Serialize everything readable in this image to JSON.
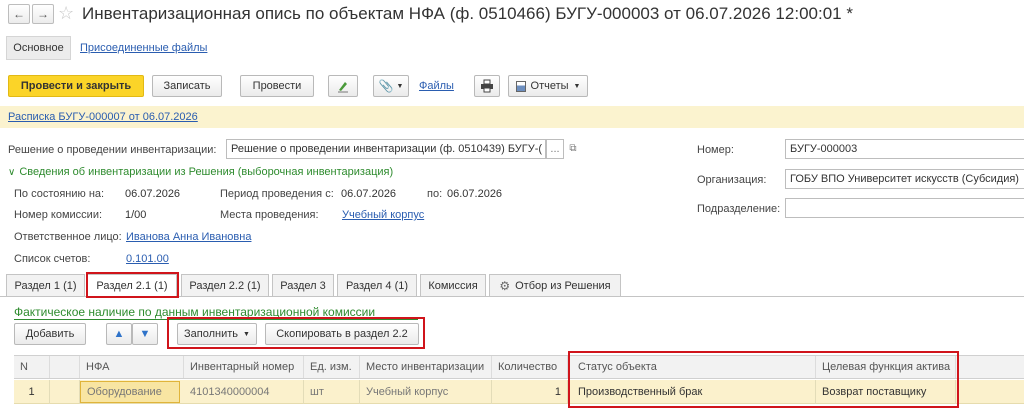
{
  "window": {
    "title": "Инвентаризационная опись по объектам НФА (ф. 0510466) БУГУ-000003 от 06.07.2026 12:00:01 *"
  },
  "top_tabs": {
    "main": "Основное",
    "attached": "Присоединенные файлы"
  },
  "toolbar": {
    "post_close": "Провести и закрыть",
    "save": "Записать",
    "post": "Провести",
    "files": "Файлы",
    "reports": "Отчеты"
  },
  "receipt_link": "Расписка БУГУ-000007 от 06.07.2026",
  "decision": {
    "label": "Решение о проведении инвентаризации:",
    "value": "Решение о проведении инвентаризации (ф. 0510439) БУГУ-("
  },
  "right_fields": {
    "number_label": "Номер:",
    "number_value": "БУГУ-000003",
    "org_label": "Организация:",
    "org_value": "ГОБУ ВПО Университет искусств (Субсидия)",
    "dept_label": "Подразделение:",
    "dept_value": ""
  },
  "section_info": {
    "title": "Сведения об инвентаризации из Решения (выборочная инвентаризация)",
    "as_of_label": "По состоянию на:",
    "as_of_value": "06.07.2026",
    "period_label": "Период проведения с:",
    "period_from": "06.07.2026",
    "period_to_label": "по:",
    "period_to": "06.07.2026",
    "commission_label": "Номер комиссии:",
    "commission_value": "1/00",
    "places_label": "Места проведения:",
    "places_value": "Учебный корпус",
    "responsible_label": "Ответственное лицо:",
    "responsible_value": "Иванова Анна Ивановна",
    "accounts_label": "Список счетов:",
    "accounts_value": "0.101.00"
  },
  "tabs": [
    "Раздел 1 (1)",
    "Раздел 2.1 (1)",
    "Раздел 2.2 (1)",
    "Раздел 3",
    "Раздел 4 (1)",
    "Комиссия",
    "Отбор из Решения"
  ],
  "section_subtitle": "Фактическое наличие по данным инвентаризационной комиссии",
  "table_toolbar": {
    "add": "Добавить",
    "fill": "Заполнить",
    "copy": "Скопировать в раздел 2.2"
  },
  "table": {
    "columns": [
      "N",
      "НФА",
      "Инвентарный номер",
      "Ед. изм.",
      "Место инвентаризации",
      "Количество",
      "Статус объекта",
      "Целевая функция актива"
    ],
    "rows": [
      [
        "1",
        "Оборудование",
        "4101340000004",
        "шт",
        "Учебный корпус",
        "1",
        "Производственный брак",
        "Возврат поставщику"
      ]
    ]
  }
}
